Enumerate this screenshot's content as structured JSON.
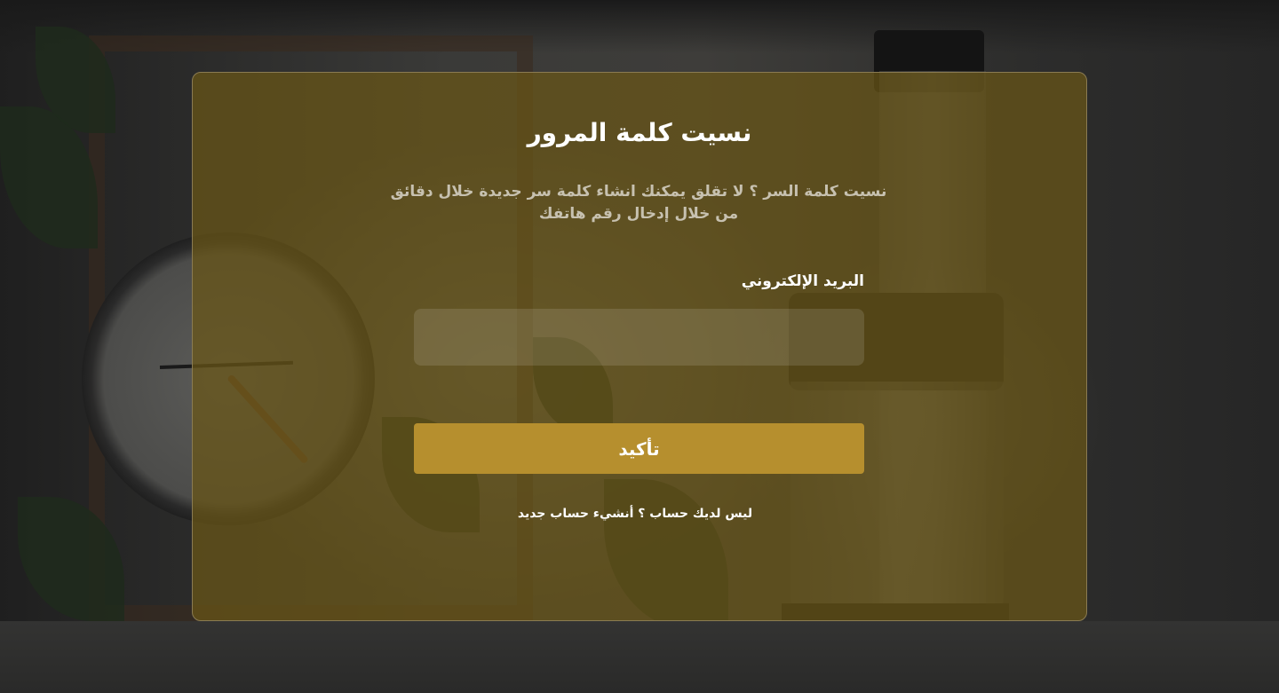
{
  "form": {
    "title": "نسيت كلمة المرور",
    "subtitle": "نسيت كلمة السر ؟ لا تقلق يمكنك انشاء كلمة سر جديدة خلال دقائق من خلال إدخال رقم هاتفك",
    "email_label": "البريد الإلكتروني",
    "email_value": "",
    "email_placeholder": "",
    "confirm_label": "تأكيد",
    "signup_link": "ليس لديك حساب ؟ أنشيء حساب جديد"
  },
  "colors": {
    "card_overlay": "#6a5616",
    "button": "#b68f2e",
    "text_primary": "#ffffff",
    "text_muted": "#c7c1b0"
  }
}
